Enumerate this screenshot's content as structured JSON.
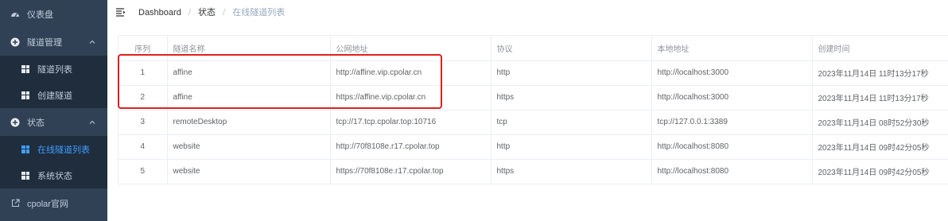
{
  "sidebar": {
    "items": [
      {
        "label": "仪表盘",
        "icon": "dashboard-icon"
      },
      {
        "label": "隧道管理",
        "icon": "plus-circle-icon",
        "expanded": true,
        "children": [
          {
            "label": "隧道列表",
            "icon": "grid-icon"
          },
          {
            "label": "创建隧道",
            "icon": "grid-icon"
          }
        ]
      },
      {
        "label": "状态",
        "icon": "plus-circle-icon",
        "expanded": true,
        "children": [
          {
            "label": "在线隧道列表",
            "icon": "grid-icon",
            "active": true
          },
          {
            "label": "系统状态",
            "icon": "grid-icon"
          }
        ]
      },
      {
        "label": "cpolar官网",
        "icon": "external-link-icon"
      }
    ]
  },
  "breadcrumb": {
    "items": [
      "Dashboard",
      "状态",
      "在线隧道列表"
    ]
  },
  "table": {
    "headers": [
      "序列",
      "隧道名称",
      "公网地址",
      "协议",
      "本地地址",
      "创建时间"
    ],
    "rows": [
      [
        "1",
        "affine",
        "http://affine.vip.cpolar.cn",
        "http",
        "http://localhost:3000",
        "2023年11月14日 11时13分17秒"
      ],
      [
        "2",
        "affine",
        "https://affine.vip.cpolar.cn",
        "https",
        "http://localhost:3000",
        "2023年11月14日 11时13分17秒"
      ],
      [
        "3",
        "remoteDesktop",
        "tcp://17.tcp.cpolar.top:10716",
        "tcp",
        "tcp://127.0.0.1:3389",
        "2023年11月14日 08时52分30秒"
      ],
      [
        "4",
        "website",
        "http://70f8108e.r17.cpolar.top",
        "http",
        "http://localhost:8080",
        "2023年11月14日 09时42分05秒"
      ],
      [
        "5",
        "website",
        "https://70f8108e.r17.cpolar.top",
        "https",
        "http://localhost:8080",
        "2023年11月14日 09时42分05秒"
      ]
    ]
  },
  "colors": {
    "sidebar_bg": "#304156",
    "submenu_bg": "#1f2d3d",
    "active": "#409eff",
    "highlight_box": "#e02020"
  }
}
